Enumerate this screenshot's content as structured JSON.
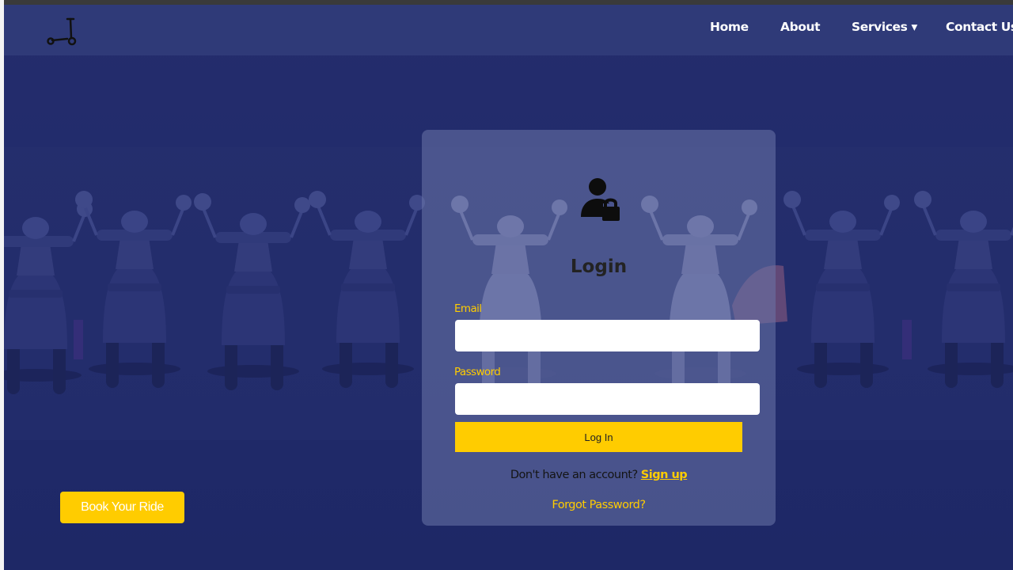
{
  "nav": {
    "logo_icon": "kick-scooter-icon",
    "links": [
      {
        "label": "Home"
      },
      {
        "label": "About"
      },
      {
        "label": "Services ▾"
      },
      {
        "label": "Contact Us"
      }
    ]
  },
  "hero": {
    "background": "row of parked electric scooters",
    "book_button_label": "Book Your Ride"
  },
  "login": {
    "icon": "user-lock-icon",
    "title": "Login",
    "email_label": "Email",
    "email_value": "",
    "password_label": "Password",
    "password_value": "",
    "submit_label": "Log In",
    "signup_prompt": "Don't have an account?",
    "signup_link": "Sign up",
    "forgot_link": "Forgot Password?"
  },
  "colors": {
    "accent": "#ffcc00",
    "navbar": "#2f3a78",
    "background": "#222b6b"
  }
}
